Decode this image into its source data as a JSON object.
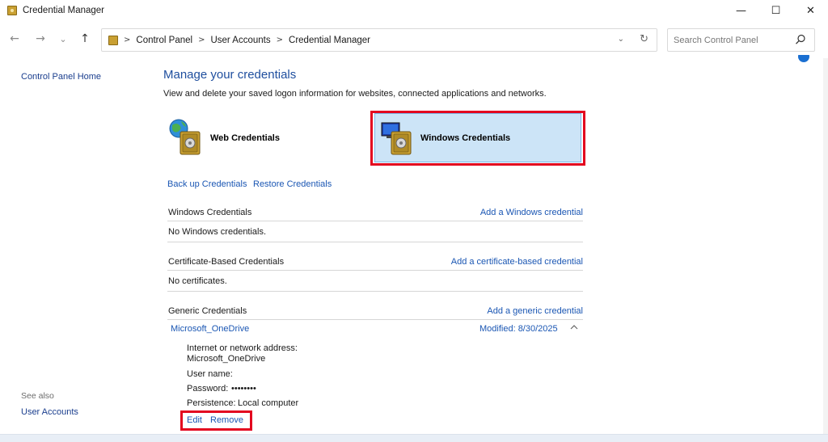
{
  "window": {
    "title": "Credential Manager"
  },
  "window_controls": {
    "minimize": "—",
    "maximize": "☐",
    "close": "✕"
  },
  "nav": {
    "back": "←",
    "forward": "→",
    "recent": "⌄",
    "up": "↑",
    "breadcrumb": [
      "Control Panel",
      "User Accounts",
      "Credential Manager"
    ],
    "dropdown": "⌄",
    "refresh": "↻",
    "search_placeholder": "Search Control Panel"
  },
  "sidebar": {
    "home_link": "Control Panel Home",
    "see_also": "See also",
    "user_accounts_link": "User Accounts"
  },
  "main": {
    "heading": "Manage your credentials",
    "description": "View and delete your saved logon information for websites, connected applications and networks.",
    "tiles": {
      "web": "Web Credentials",
      "windows": "Windows Credentials"
    },
    "backup_link": "Back up Credentials",
    "restore_link": "Restore Credentials",
    "sections": {
      "windows": {
        "title": "Windows Credentials",
        "add": "Add a Windows credential",
        "empty": "No Windows credentials."
      },
      "certificate": {
        "title": "Certificate-Based Credentials",
        "add": "Add a certificate-based credential",
        "empty": "No certificates."
      },
      "generic": {
        "title": "Generic Credentials",
        "add": "Add a generic credential"
      }
    },
    "entry": {
      "name": "Microsoft_OneDrive",
      "modified": "Modified:  8/30/2025",
      "address_label": "Internet or network address:",
      "address_value": "Microsoft_OneDrive",
      "username_label": "User name:",
      "password_label": "Password:",
      "password_value": "••••••••",
      "persistence_label": "Persistence:",
      "persistence_value": "Local computer",
      "edit": "Edit",
      "remove": "Remove"
    }
  },
  "colors": {
    "link": "#1a56b3",
    "heading": "#1e4e9e",
    "highlight": "#e3051f",
    "selected_tile": "#cce4f7"
  }
}
